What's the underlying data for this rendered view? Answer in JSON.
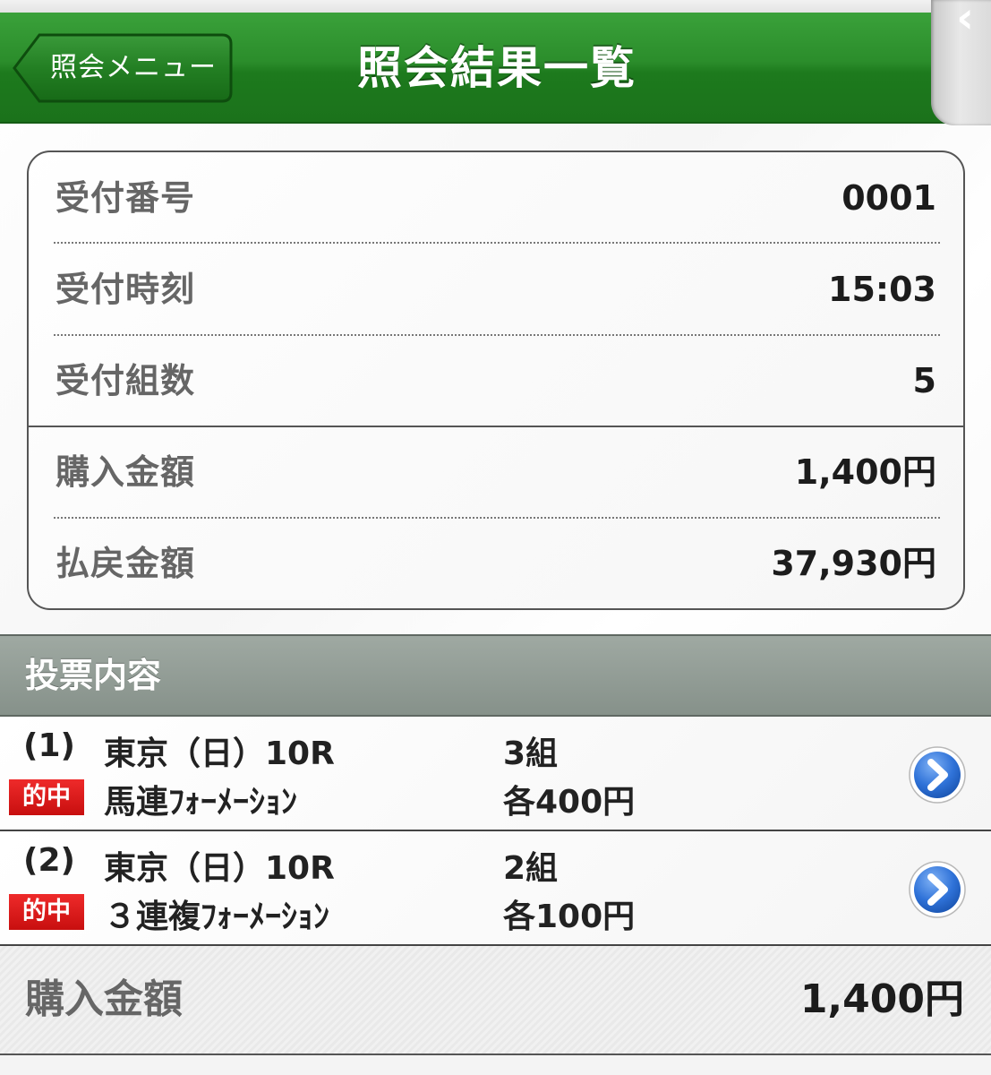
{
  "header": {
    "back_label": "照会メニュー",
    "title": "照会結果一覧"
  },
  "summary": {
    "rows": [
      {
        "label": "受付番号",
        "value": "0001"
      },
      {
        "label": "受付時刻",
        "value": "15:03"
      },
      {
        "label": "受付組数",
        "value": "5"
      },
      {
        "label": "購入金額",
        "value": "1,400円"
      },
      {
        "label": "払戻金額",
        "value": "37,930円"
      }
    ]
  },
  "section": {
    "title": "投票内容"
  },
  "bets": [
    {
      "number": "(1)",
      "race": "東京（日）10R",
      "combos": "3組",
      "badge": "的中",
      "type": "馬連ﾌｫｰﾒｰｼｮﾝ",
      "each": "各400円"
    },
    {
      "number": "(2)",
      "race": "東京（日）10R",
      "combos": "2組",
      "badge": "的中",
      "type": "３連複ﾌｫｰﾒｰｼｮﾝ",
      "each": "各100円"
    }
  ],
  "footer": {
    "label": "購入金額",
    "value": "1,400円"
  },
  "colors": {
    "header_green": "#2b8d2b",
    "hit_red": "#d81818",
    "arrow_blue": "#2a6fd6",
    "section_gray": "#939d96"
  },
  "icons": {
    "back": "chevron-left-icon",
    "side_tab": "chevron-left-icon",
    "row_arrow": "chevron-right-circle-icon"
  }
}
